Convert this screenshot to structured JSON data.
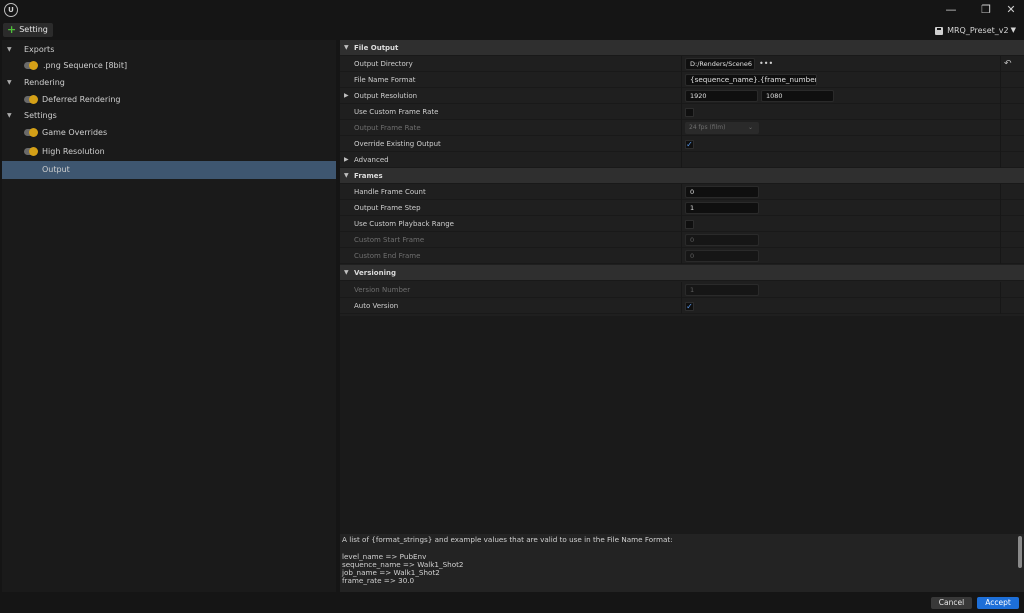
{
  "window": {
    "logo_text": "U",
    "minimize_glyph": "—",
    "restore_glyph": "❐",
    "close_glyph": "✕"
  },
  "toolbar": {
    "add_setting_label": "Setting",
    "preset_label": "MRQ_Preset_v2"
  },
  "tree": {
    "exports_label": "Exports",
    "png_label": ".png Sequence [8bit]",
    "rendering_label": "Rendering",
    "deferred_label": "Deferred Rendering",
    "settings_label": "Settings",
    "game_overrides_label": "Game Overrides",
    "high_res_label": "High Resolution",
    "output_label": "Output"
  },
  "details": {
    "file_output": {
      "header": "File Output",
      "output_directory_label": "Output Directory",
      "output_directory_value": "D:/Renders/Scene6",
      "browse_glyph": "•••",
      "file_name_format_label": "File Name Format",
      "file_name_format_value": "{sequence_name}.{frame_number}",
      "output_resolution_label": "Output Resolution",
      "resolution_x": "1920",
      "resolution_y": "1080",
      "use_custom_frame_rate_label": "Use Custom Frame Rate",
      "output_frame_rate_label": "Output Frame Rate",
      "output_frame_rate_value": "24 fps (film)",
      "override_existing_label": "Override Existing Output",
      "advanced_label": "Advanced"
    },
    "frames": {
      "header": "Frames",
      "handle_frame_count_label": "Handle Frame Count",
      "handle_frame_count_value": "0",
      "output_frame_step_label": "Output Frame Step",
      "output_frame_step_value": "1",
      "use_custom_playback_label": "Use Custom Playback Range",
      "custom_start_label": "Custom Start Frame",
      "custom_start_value": "0",
      "custom_end_label": "Custom End Frame",
      "custom_end_value": "0"
    },
    "versioning": {
      "header": "Versioning",
      "version_number_label": "Version Number",
      "version_number_value": "1",
      "auto_version_label": "Auto Version"
    }
  },
  "description": {
    "intro": "A list of {format_strings} and example values that are valid to use in the File Name Format:",
    "line1": "level_name => PubEnv",
    "line2": "sequence_name => Walk1_Shot2",
    "line3": "job_name => Walk1_Shot2",
    "line4": "frame_rate => 30.0"
  },
  "footer": {
    "cancel_label": "Cancel",
    "accept_label": "Accept"
  },
  "checkboxes": {
    "use_custom_frame_rate": false,
    "override_existing_output": true,
    "use_custom_playback_range": false,
    "auto_version": true
  },
  "colors": {
    "accent": "#1d6fd8",
    "selection": "#3e5670",
    "toggle_knob": "#d4a017",
    "add_plus": "#4fbf3a",
    "check": "#5a9bf0"
  }
}
